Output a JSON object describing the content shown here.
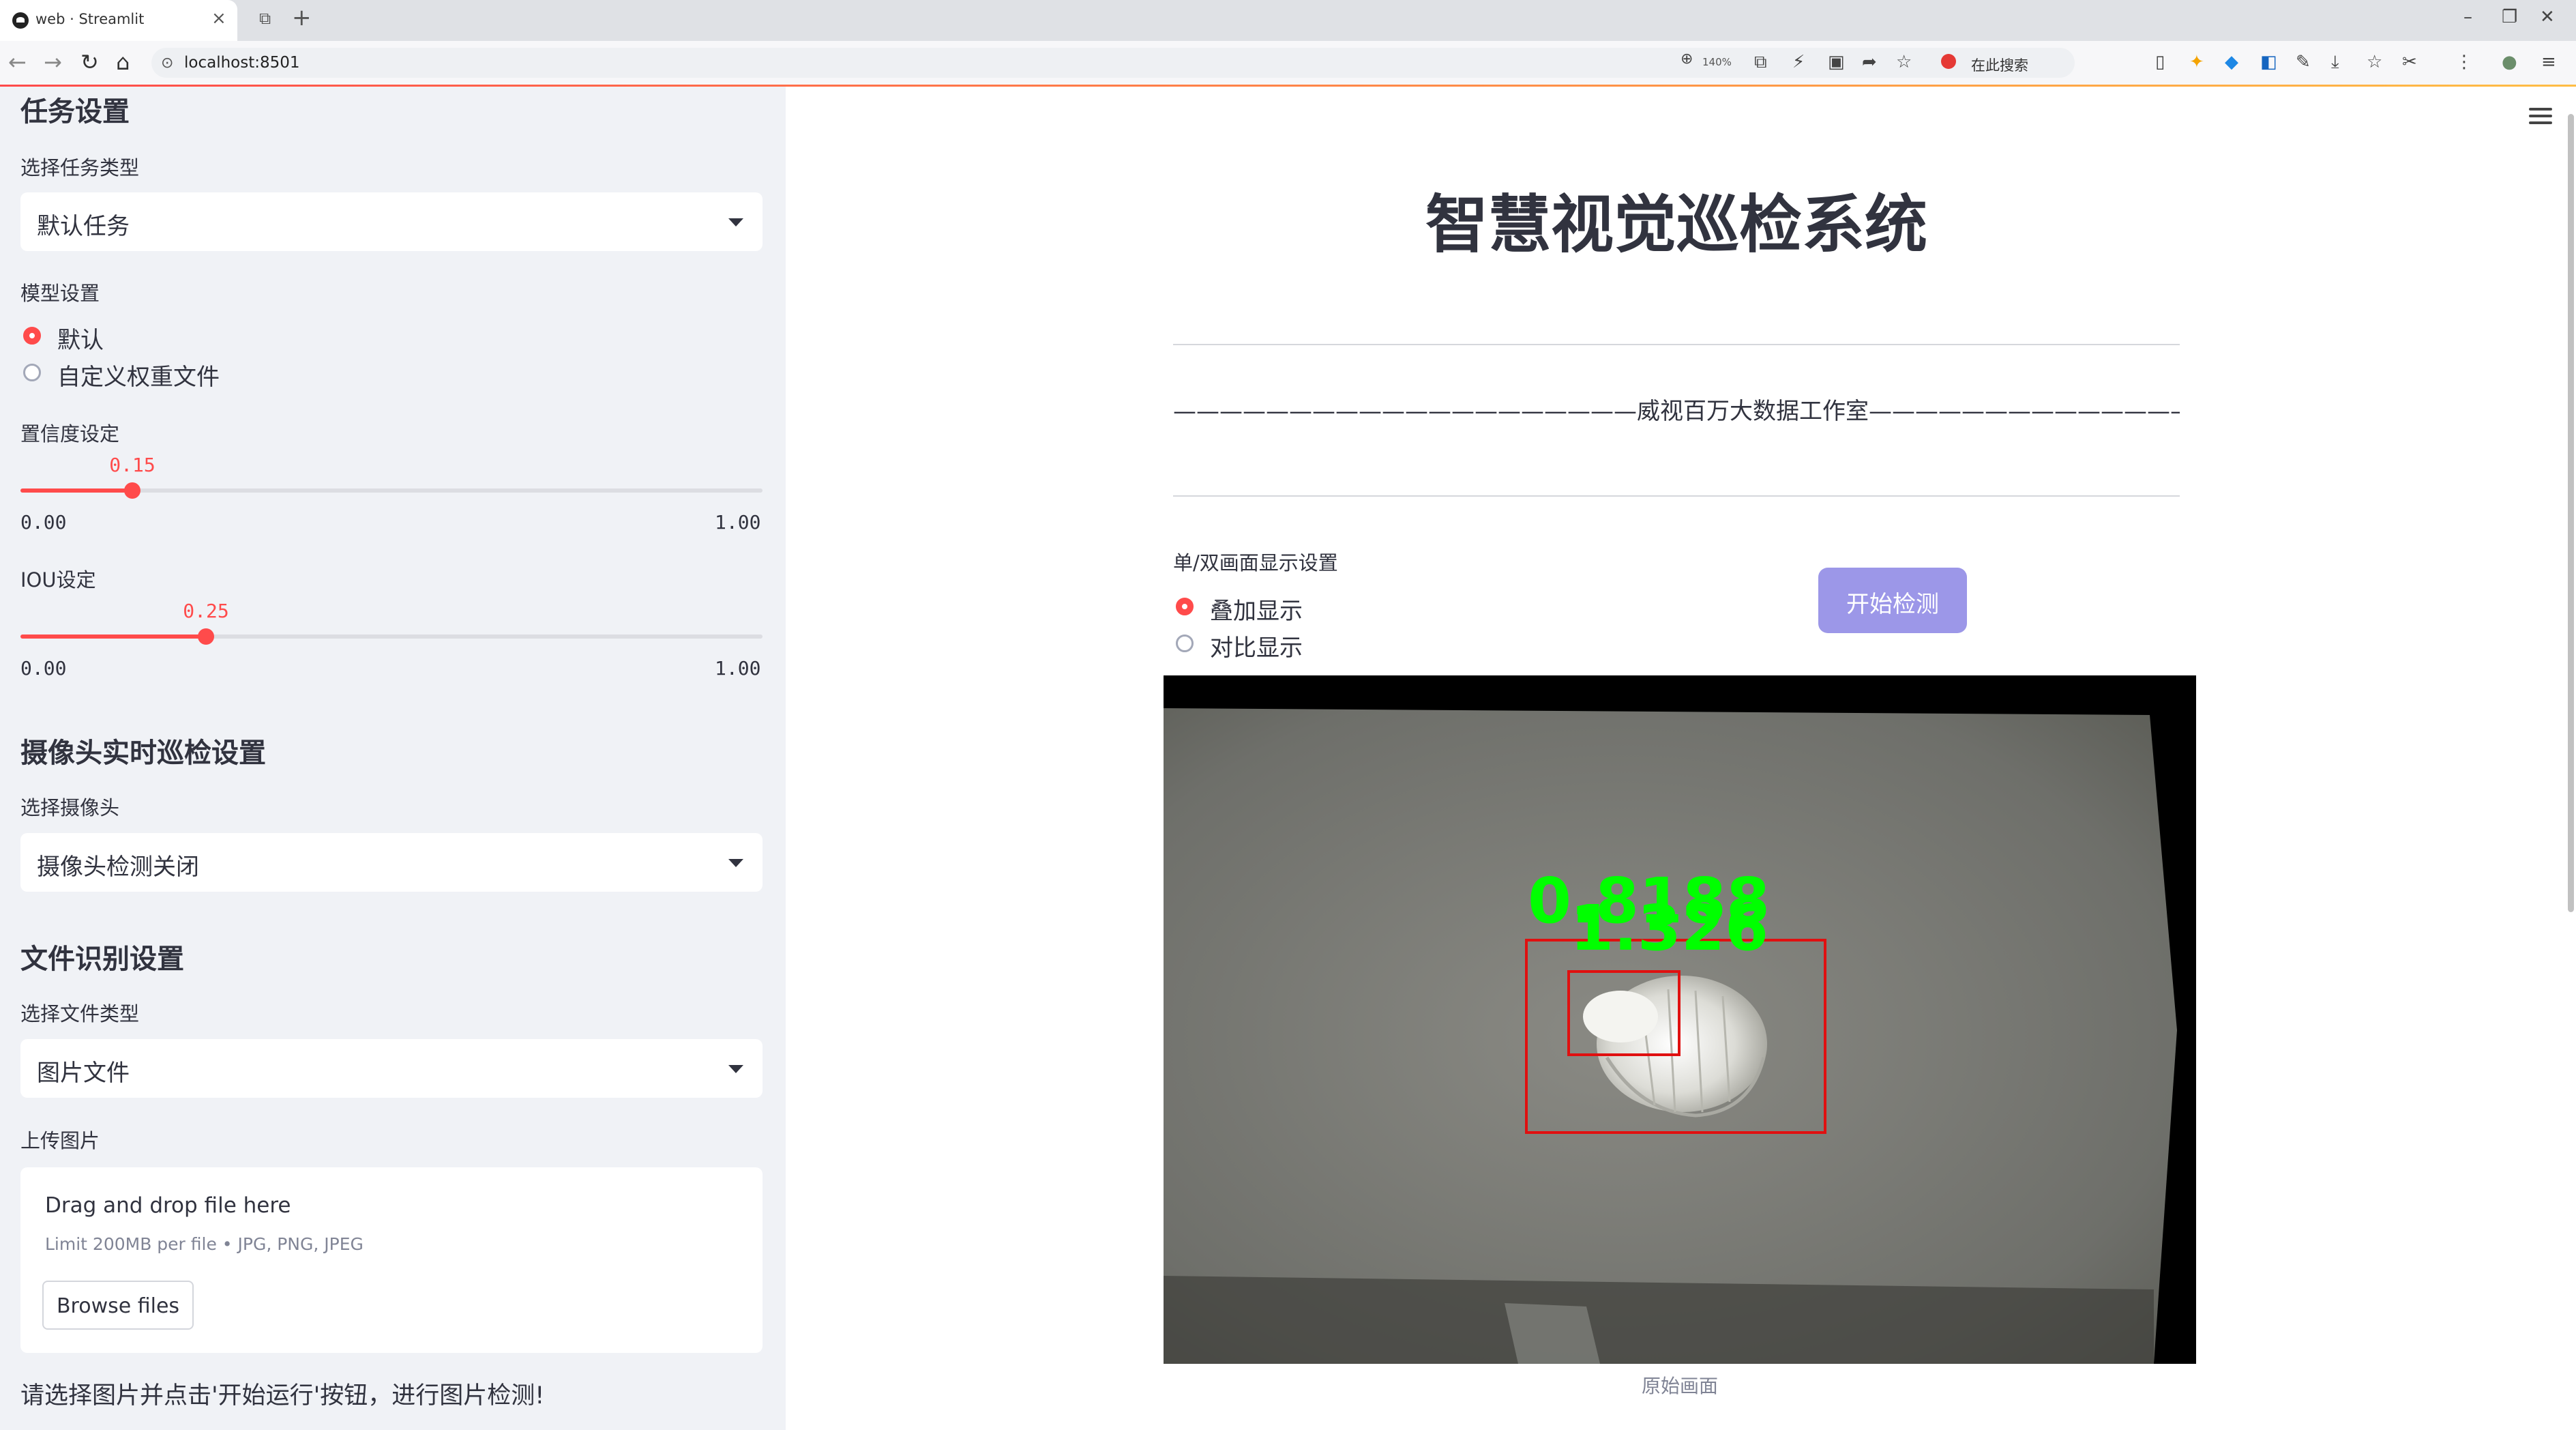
{
  "browser": {
    "tab_title": "web · Streamlit",
    "url": "localhost:8501",
    "zoom": "140%",
    "search_placeholder": "在此搜索"
  },
  "sidebar": {
    "task_heading": "任务设置",
    "task_type_label": "选择任务类型",
    "task_type_value": "默认任务",
    "model_label": "模型设置",
    "model_options": [
      "默认",
      "自定义权重文件"
    ],
    "model_selected": "默认",
    "confidence": {
      "label": "置信度设定",
      "value": "0.15",
      "min": "0.00",
      "max": "1.00"
    },
    "iou": {
      "label": "IOU设定",
      "value": "0.25",
      "min": "0.00",
      "max": "1.00"
    },
    "camera_heading": "摄像头实时巡检设置",
    "camera_label": "选择摄像头",
    "camera_value": "摄像头检测关闭",
    "file_heading": "文件识别设置",
    "file_type_label": "选择文件类型",
    "file_type_value": "图片文件",
    "upload_label": "上传图片",
    "upload": {
      "drop_text": "Drag and drop file here",
      "limit_text": "Limit 200MB per file • JPG, PNG, JPEG",
      "browse_label": "Browse files"
    },
    "hint": "请选择图片并点击'开始运行'按钮，进行图片检测!"
  },
  "main": {
    "title": "智慧视觉巡检系统",
    "subtitle": "————————————————————威视百万大数据工作室—————————————————————",
    "display_label": "单/双画面显示设置",
    "display_options": [
      "叠加显示",
      "对比显示"
    ],
    "display_selected": "叠加显示",
    "start_button": "开始检测",
    "detections": [
      {
        "score_text": "0.8188"
      },
      {
        "score_text": "1.326"
      }
    ],
    "caption": "原始画面"
  },
  "colors": {
    "accent": "#ff4b4b",
    "button": "#9c97e8",
    "sidebar_bg": "#f0f2f6",
    "detection_box": "#e01010",
    "detection_label": "#00ff00"
  }
}
